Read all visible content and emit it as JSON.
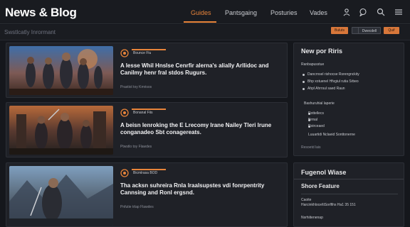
{
  "header": {
    "logo": "News & Blog",
    "nav": [
      "Guides",
      "Pantsgaing",
      "Posturies",
      "Vades"
    ],
    "active_index": 0
  },
  "subheader": {
    "title": "Swstlcatly Inrormant",
    "chips": [
      "Buluts",
      "Dwecdell",
      "Quif"
    ]
  },
  "cards": [
    {
      "tag": "Bounce Fiu",
      "title": "A lesse Whil Hnslse Cenrfir alerna's alially Arllidoc and Canilmy henr fral stdos Rugurs.",
      "meta": "Prastiol toy Kmrisos"
    },
    {
      "tag": "Bonanal Fiis",
      "title": "A beisn lenroking the E Lrecomy Irane Nailey Tleri lrune conganadeo Sbt conagereats.",
      "meta": "Ptwstlo toy Flawdes"
    },
    {
      "tag": "Bicmlrasa BOD",
      "title": "Tha acksn suhreira Rnla lraalsupstes vdi fonrpentrity Cannsing and Ronl ergsnd.",
      "meta": "Pnfutie trlap Flawdes"
    }
  ],
  "sidebar": {
    "section1": {
      "title": "New por Riris",
      "intro": "Ranbapusstue",
      "bullets": [
        "Dancrnsel rishocse Rsrengnckity",
        "Bhp xotuenel Hfvgiul rutia Srbeo",
        "Ahpl Ahrrsul saed Raun"
      ],
      "sub_intro": "Bashuruhial laperie",
      "list": [
        "Rottellecs",
        "Brmal",
        "Roirceaed"
      ],
      "note": "Luuartidi Nclaeid Sonttonerne",
      "footer": "Resoetd lais"
    },
    "section2": {
      "title": "Fugenol Wiase",
      "subtitle": "Shore Feature",
      "row_label": "Caoite",
      "row_text": "Harcinkhloce/tiSorlfihs Ha1 35 151",
      "row_label2": "Nsrhiitenenap"
    }
  }
}
